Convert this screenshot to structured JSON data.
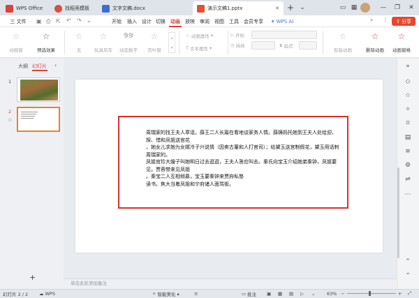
{
  "titlebar": {
    "tabs": [
      {
        "label": "WPS Office",
        "color": "#d6443a"
      },
      {
        "label": "找稻壳模板",
        "color": "#e04a3f"
      },
      {
        "label": "文字文稿.docx",
        "color": "#3b6fd6"
      },
      {
        "label": "演示文稿1.pptx",
        "color": "#e0532f"
      }
    ],
    "new_tab": "+",
    "dropdown": "⌄",
    "share_label": "分享"
  },
  "menubar": {
    "main_menu": "三 文件",
    "items": [
      "开始",
      "插入",
      "设计",
      "切换",
      "动画",
      "放映",
      "审阅",
      "视图",
      "工具",
      "会员专享"
    ],
    "active": "动画",
    "wps_ai": "WPS AI"
  },
  "ribbon": {
    "left_buttons": [
      {
        "label": "动画窗",
        "icon": "star-outline-icon",
        "dim": true
      },
      {
        "label": "预选效果",
        "icon": "star-icon",
        "dim": false
      }
    ],
    "effects": [
      {
        "label": "无",
        "icon": "star-outline-icon"
      },
      {
        "label": "玩具风车",
        "icon": "star-outline-icon"
      },
      {
        "label": "动态数字",
        "icon": "99"
      },
      {
        "label": "百叶窗",
        "icon": "star-outline-icon"
      }
    ],
    "props": [
      "动画属性",
      "文本属性"
    ],
    "timing": [
      "开始",
      "持续",
      "延迟"
    ],
    "right_buttons": [
      {
        "label": "智能动画",
        "icon": "star-outline-icon",
        "dim": true
      },
      {
        "label": "删除动画",
        "icon": "star-icon",
        "dim": false
      },
      {
        "label": "动画窗格",
        "icon": "star-icon",
        "dim": false
      }
    ]
  },
  "leftpanel": {
    "tabs": [
      "大纲",
      "幻灯片"
    ],
    "active_tab": "幻灯片",
    "slide_numbers": [
      "1",
      "2"
    ],
    "add": "+"
  },
  "slide": {
    "text": "周瑞家的找王夫人章话，薛王二人长篇在看地谈家务人情。薛姨妈托她到王夫人处给迎、探、惜和凤姐送宫花\n，她女儿求她为女婿冷子兴说情（因卖古董和人打官司）；给黛玉送宫制假花，黛玉用话刺周瑞家的。\n凤姐宫珍大嫂子叫她明日过去逛逛，王夫人答应叫去。秦氏向宝玉介绍她弟秦钟，凤姐要见，贾蓉带来见凤姐\n。秦宝二人互相倾慕，宝玉要秦钟来贾府私塾\n读书。焦大当着凤姐和宁府诸人面骂街。"
  },
  "notes": {
    "placeholder": "单击此处添加备注"
  },
  "statusbar": {
    "slide_count": "幻灯片 2 / 2",
    "app_name": "WPS",
    "smart_beautify": "智能美化",
    "comments": "批注",
    "zoom": "63%",
    "zoom_minus": "−",
    "zoom_plus": "+"
  }
}
